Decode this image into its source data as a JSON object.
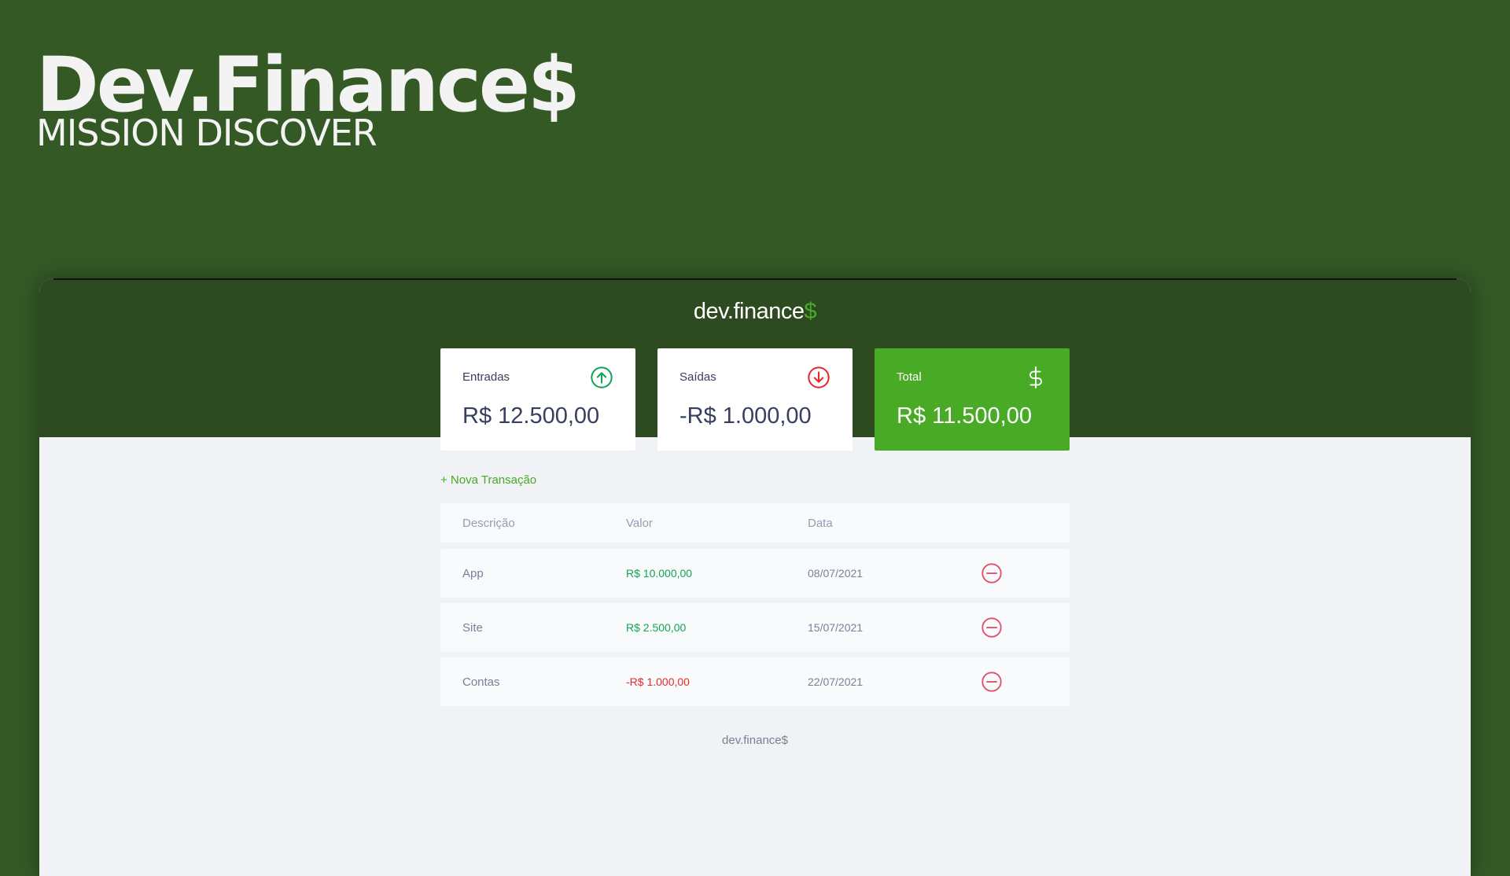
{
  "hero": {
    "title": "Dev.Finance$",
    "subtitle": "MISSION DISCOVER"
  },
  "app": {
    "logo_main": "dev.finance",
    "logo_dollar": "$"
  },
  "cards": {
    "income": {
      "label": "Entradas",
      "value": "R$ 12.500,00",
      "icon": "arrow-up-circle-icon",
      "icon_color": "#12a454"
    },
    "expense": {
      "label": "Saídas",
      "value": "-R$ 1.000,00",
      "icon": "arrow-down-circle-icon",
      "icon_color": "#e92929"
    },
    "total": {
      "label": "Total",
      "value": "R$ 11.500,00",
      "icon": "dollar-sign-icon",
      "background": "#49aa26"
    }
  },
  "new_transaction_label": "+ Nova Transação",
  "table": {
    "headers": [
      "Descrição",
      "Valor",
      "Data"
    ],
    "rows": [
      {
        "description": "App",
        "amount": "R$ 10.000,00",
        "date": "08/07/2021",
        "type": "income"
      },
      {
        "description": "Site",
        "amount": "R$ 2.500,00",
        "date": "15/07/2021",
        "type": "income"
      },
      {
        "description": "Contas",
        "amount": "-R$ 1.000,00",
        "date": "22/07/2021",
        "type": "expense"
      }
    ]
  },
  "footer": "dev.finance$",
  "colors": {
    "page_background": "#345925",
    "header_background": "#2e4a20",
    "accent": "#49aa26",
    "income": "#12a454",
    "expense": "#e92929"
  }
}
